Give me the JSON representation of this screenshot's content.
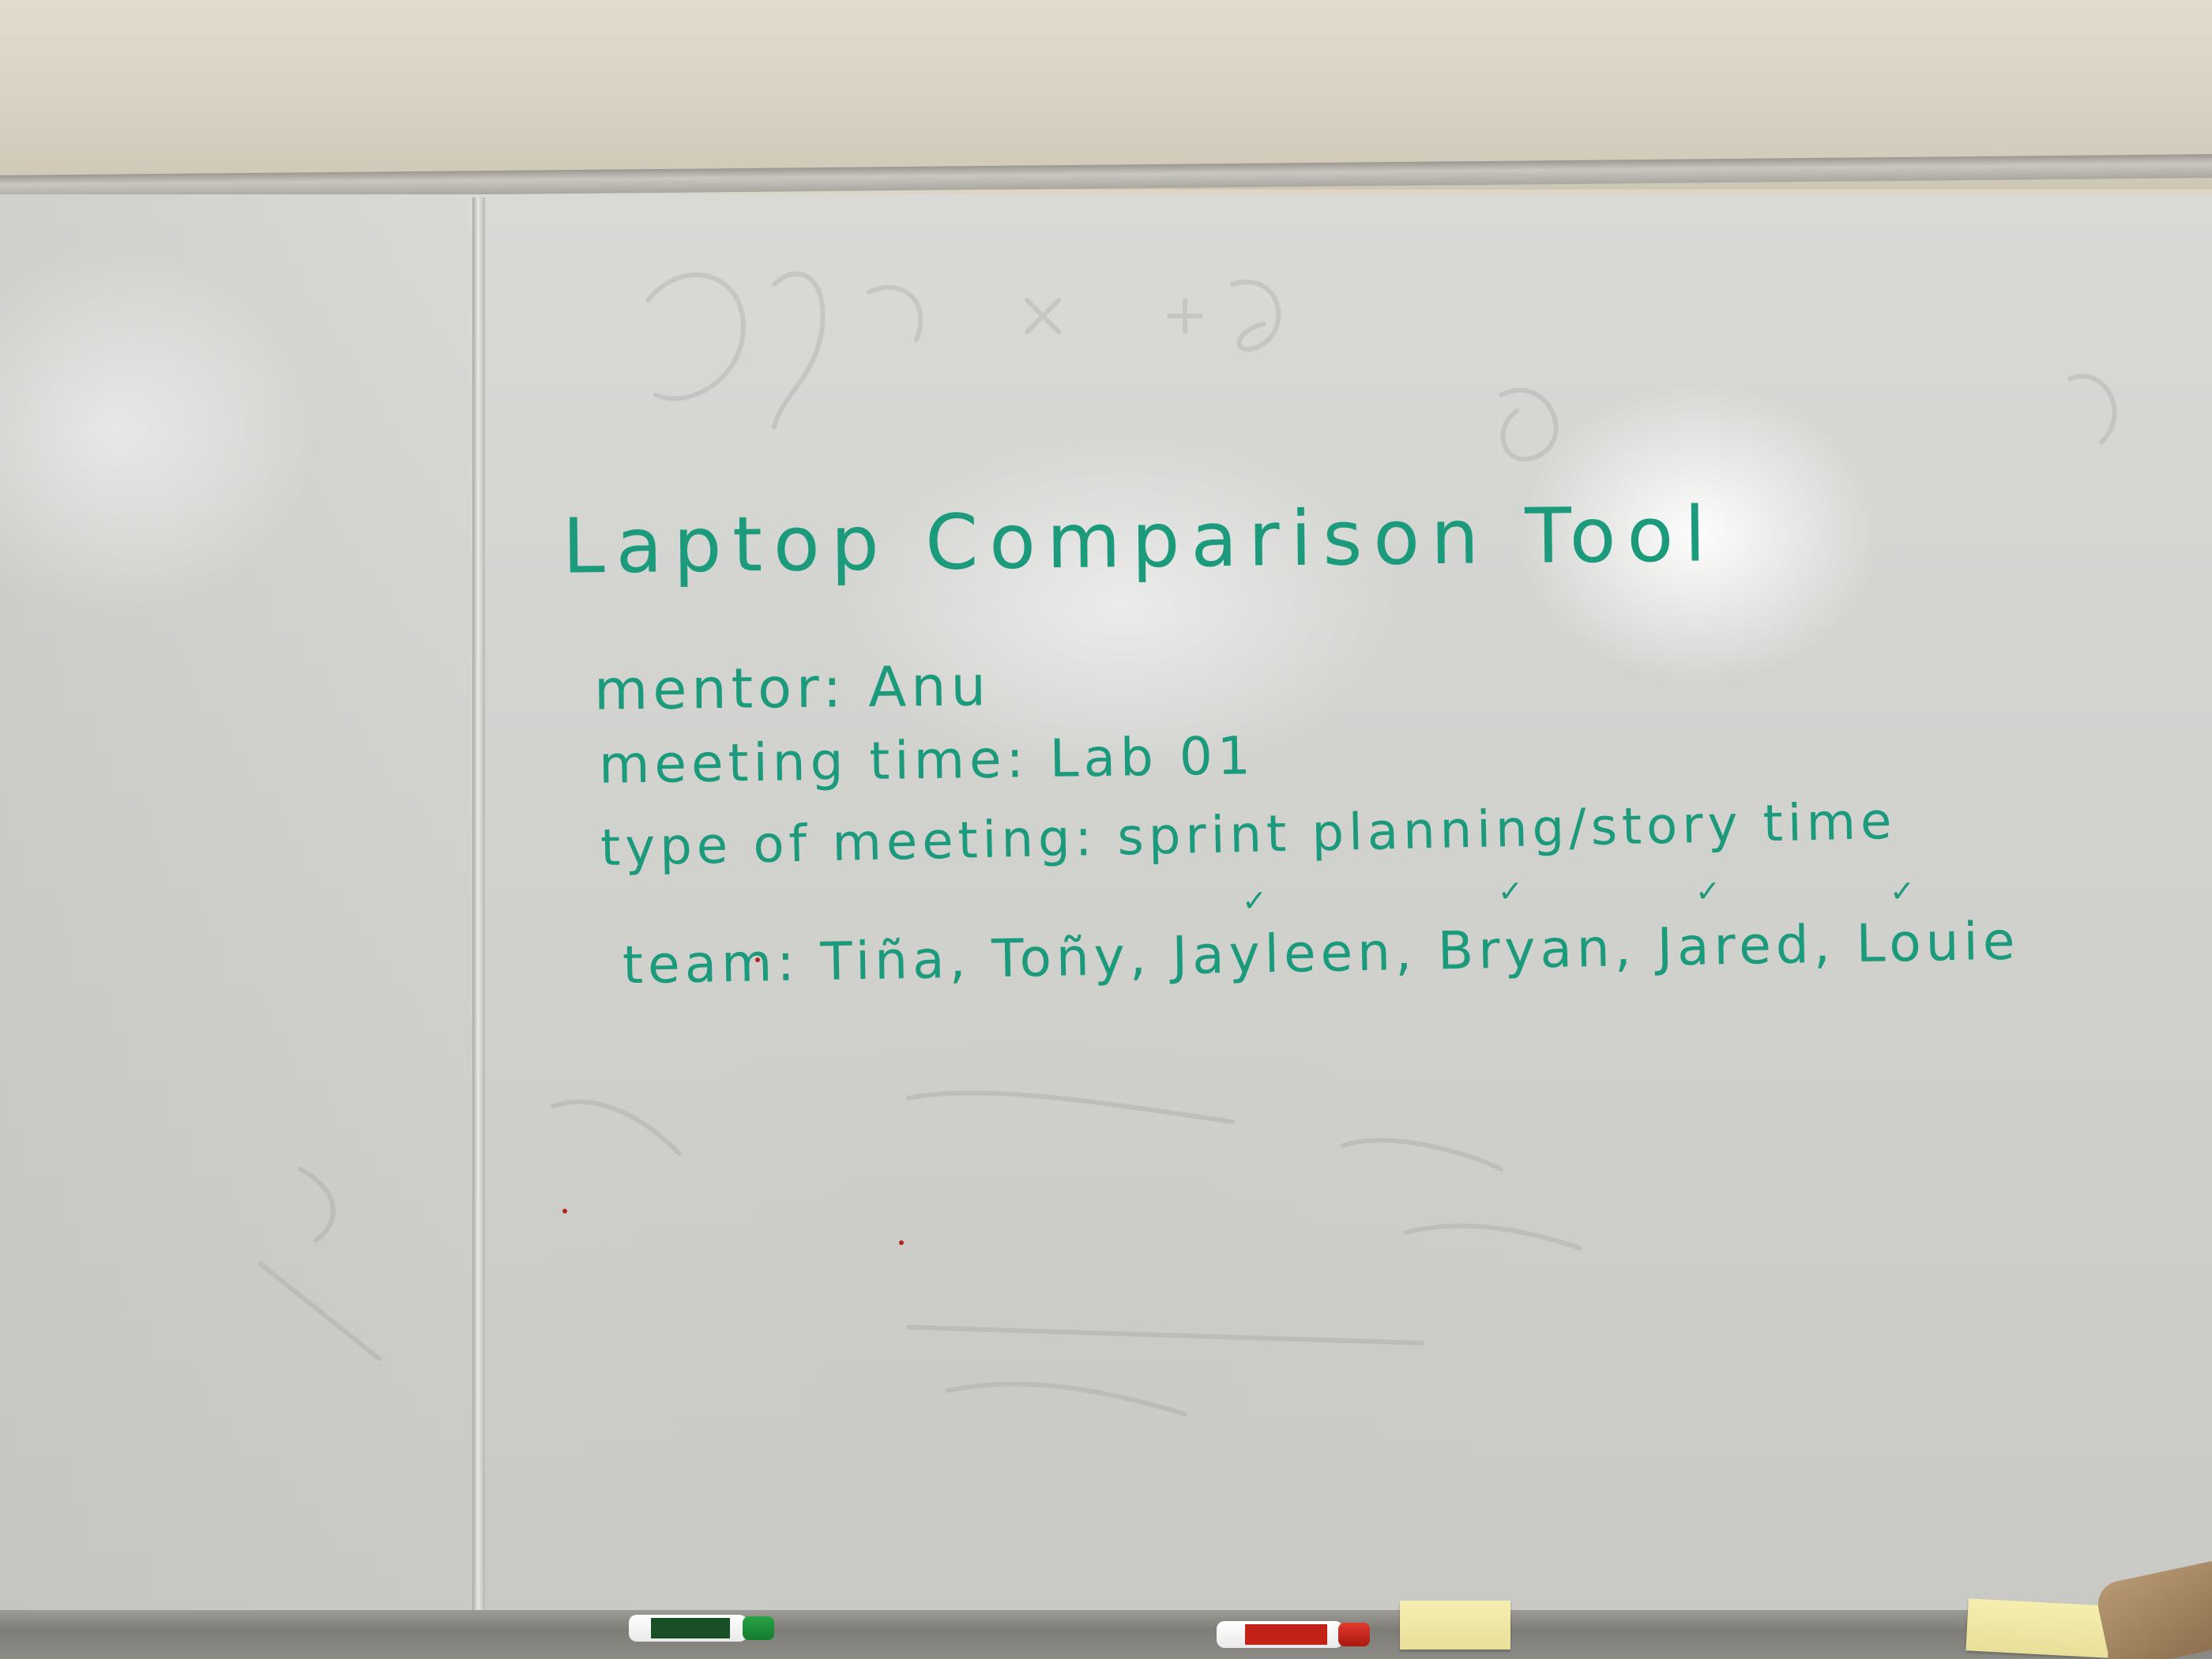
{
  "whiteboard": {
    "title": "Laptop Comparison Tool",
    "mentor_line": "mentor: Anu",
    "meeting_time_line": "meeting time: Lab 01",
    "meeting_type_line": "type of meeting: sprint planning/story time",
    "team_line": "team: Tiña, Toñy, Jayleen, Bryan, Jared, Louie"
  },
  "tray_items": {
    "green_marker": "icon:green-dry-erase-marker",
    "red_marker": "icon:red-dry-erase-marker",
    "sticky_notes": "icon:yellow-sticky-notes"
  },
  "colors": {
    "ink": "#1c9a7c",
    "board": "#d5d5d2",
    "wall": "#ddd6c6"
  }
}
